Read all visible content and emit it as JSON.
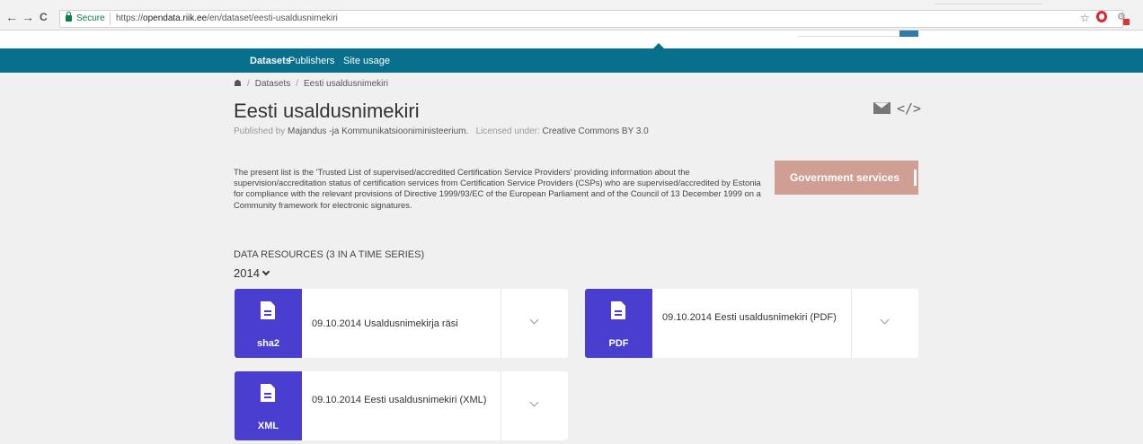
{
  "browser": {
    "back": "←",
    "forward": "→",
    "reload": "C",
    "secure_label": "Secure",
    "url_prefix": "https://",
    "url_domain": "opendata.riik.ee",
    "url_path": "/en/dataset/eesti-usaldusnimekiri"
  },
  "nav": {
    "datasets": "Datasets",
    "publishers": "Publishers",
    "site_usage": "Site usage"
  },
  "breadcrumb": {
    "home_icon": "⌂",
    "datasets": "Datasets",
    "current": "Eesti usaldusnimekiri"
  },
  "dataset": {
    "title": "Eesti usaldusnimekiri",
    "published_by_label": "Published by",
    "publisher": "Majandus -ja Kommunikatsiooniministeerium.",
    "license_label": "Licensed under:",
    "license": "Creative Commons BY 3.0",
    "description": "The present list is the 'Trusted List of supervised/accredited Certification Service Providers' providing information about the supervision/accreditation status of certification services from Certification Service Providers (CSPs) who are supervised/accredited by Estonia for compliance with the relevant provisions of Directive 1999/93/EC of the European Parliament and of the Council of 13 December 1999 on a Community framework for electronic signatures.",
    "category_button": "Government services"
  },
  "resources": {
    "heading": "DATA RESOURCES (3 IN A TIME SERIES)",
    "year": "2014",
    "items": [
      {
        "format": "sha2",
        "title": "09.10.2014 Usaldusnimekirja räsi"
      },
      {
        "format": "PDF",
        "title": "09.10.2014 Eesti usaldusnimekiri (PDF)"
      },
      {
        "format": "XML",
        "title": "09.10.2014 Eesti usaldusnimekiri (XML)"
      }
    ]
  },
  "colors": {
    "nav_bg": "#086f8d",
    "badge_bg": "#4a3ed1",
    "category_button_bg": "#cf9f94"
  }
}
